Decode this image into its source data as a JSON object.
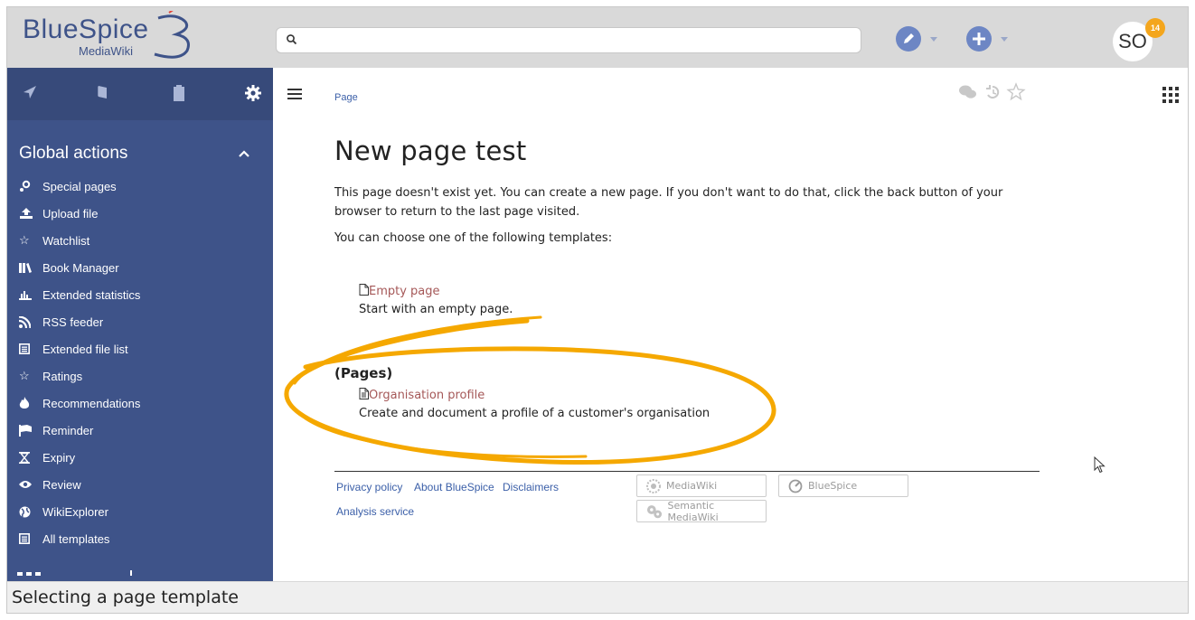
{
  "header": {
    "logo_text": "BlueSpice",
    "logo_sub": "MediaWiki",
    "search_placeholder": "",
    "avatar_initials": "SO",
    "notification_count": "14",
    "edit_icon": "pencil-icon",
    "new_icon": "plus-icon"
  },
  "sidebar": {
    "tabs": [
      "navigation-icon",
      "book-icon",
      "clipboard-icon",
      "gear-icon"
    ],
    "heading": "Global actions",
    "items": [
      {
        "label": "Special pages",
        "icon": "special-pages-icon"
      },
      {
        "label": "Upload file",
        "icon": "upload-icon"
      },
      {
        "label": "Watchlist",
        "icon": "star-outline-icon"
      },
      {
        "label": "Book Manager",
        "icon": "books-icon"
      },
      {
        "label": "Extended statistics",
        "icon": "chart-icon"
      },
      {
        "label": "RSS feeder",
        "icon": "rss-icon"
      },
      {
        "label": "Extended file list",
        "icon": "list-icon"
      },
      {
        "label": "Ratings",
        "icon": "star-outline-icon"
      },
      {
        "label": "Recommendations",
        "icon": "fire-icon"
      },
      {
        "label": "Reminder",
        "icon": "flag-icon"
      },
      {
        "label": "Expiry",
        "icon": "hourglass-icon"
      },
      {
        "label": "Review",
        "icon": "eye-icon"
      },
      {
        "label": "WikiExplorer",
        "icon": "globe-icon"
      },
      {
        "label": "All templates",
        "icon": "list-icon"
      }
    ]
  },
  "main": {
    "breadcrumb": "Page",
    "title": "New page test",
    "intro": "This page doesn't exist yet. You can create a new page. If you don't want to do that, click the back button of your browser to return to the last page visited.",
    "choose_text": "You can choose one of the following templates:",
    "templates": {
      "empty": {
        "link": "Empty page",
        "desc": "Start with an empty page."
      },
      "group_heading": "(Pages)",
      "org": {
        "link": "Organisation profile",
        "desc": "Create and document a profile of a customer's organisation"
      }
    }
  },
  "footer": {
    "links": [
      "Privacy policy",
      "About BlueSpice",
      "Disclaimers",
      "Analysis service"
    ],
    "powered": [
      "MediaWiki",
      "BlueSpice",
      "Semantic MediaWiki"
    ]
  },
  "caption": "Selecting a page template",
  "colors": {
    "brand": "#3e5389",
    "highlight": "#f5a800",
    "badge": "#f4a61d",
    "link": "#3b5fa8",
    "template_link": "#a55858"
  }
}
